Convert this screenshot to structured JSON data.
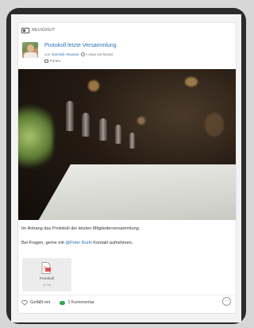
{
  "post": {
    "badge": "NEUIGKEIT",
    "title": "Protokoll letzte Versammlung",
    "meta_prefix": "von",
    "author": "Dominik Heusser",
    "meta_time": "• etwa ein Monat",
    "forum": "Forum"
  },
  "content": {
    "line1": "Im Anhang das Protokoll der letzten Mitgliederversammlung.",
    "line2_before": "Bei Fragen, gerne mit",
    "mention": "@Peter Burki",
    "line2_after": "Kontakt aufnehmen."
  },
  "attachment": {
    "name": "Protokoll",
    "size": "22 kB",
    "icon": "pdf-file-icon"
  },
  "actions": {
    "like_label": "Gefällt mir",
    "comment_label": "1 Kommentar",
    "more_symbol": "···"
  },
  "colors": {
    "link": "#2f6fb2",
    "comment_badge": "#2ea44f",
    "pdf_badge": "#d9534f"
  }
}
